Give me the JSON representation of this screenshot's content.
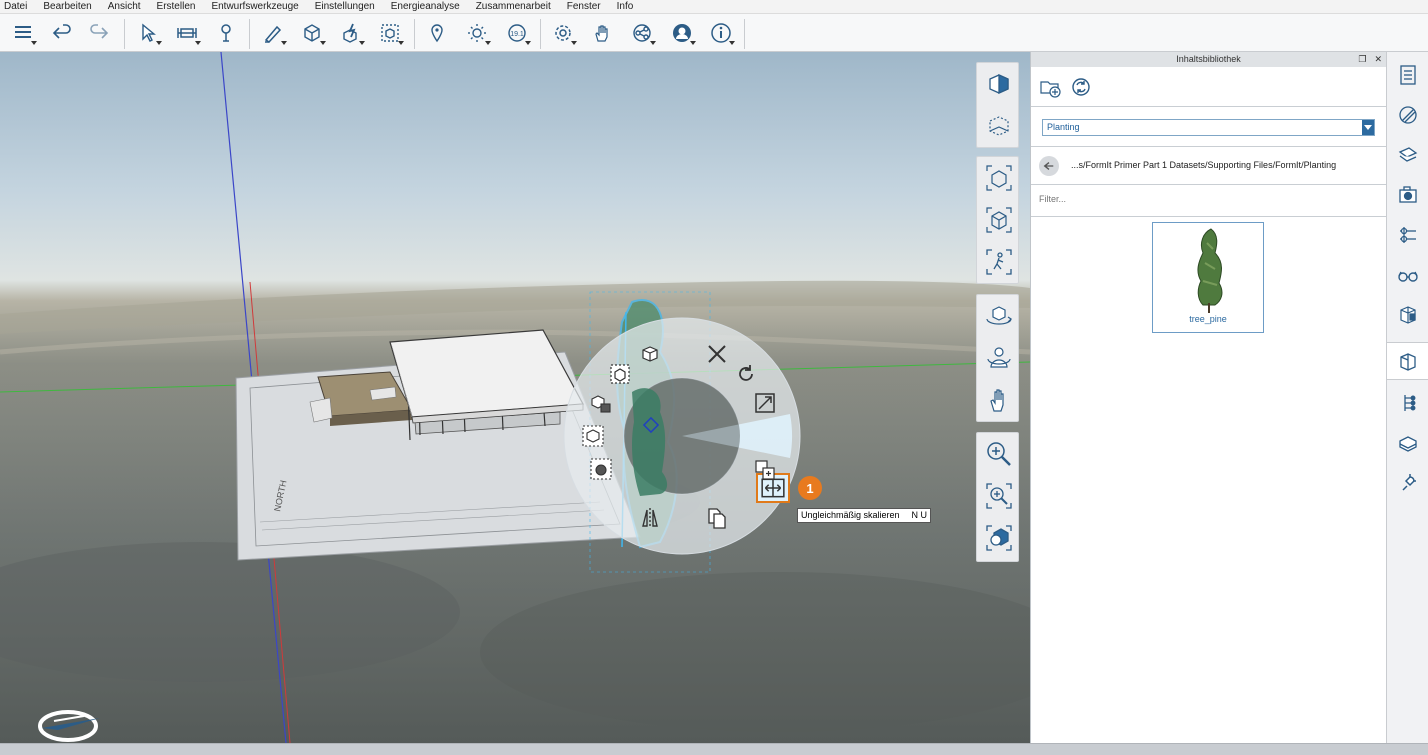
{
  "menu": [
    "Datei",
    "Bearbeiten",
    "Ansicht",
    "Erstellen",
    "Entwurfswerkzeuge",
    "Einstellungen",
    "Energieanalyse",
    "Zusammenarbeit",
    "Fenster",
    "Info"
  ],
  "toolbar": {
    "icons": [
      "layers-icon",
      "undo-icon",
      "redo-icon",
      "select-icon",
      "measure-icon",
      "paint-icon",
      "sketch-icon",
      "box-icon",
      "extrude-icon",
      "group-icon",
      "location-icon",
      "sun-icon",
      "date-icon",
      "settings-icon",
      "hand-icon",
      "share-icon",
      "user-icon",
      "info-icon"
    ]
  },
  "marking_menu": {
    "selected_tool": "nonuniform-scale",
    "callout_number": "1",
    "tooltip": {
      "label": "Ungleichmäßig skalieren",
      "shortcut": "N U"
    }
  },
  "panel": {
    "title": "Inhaltsbibliothek",
    "category": "Planting",
    "path": "...s/FormIt Primer Part 1 Datasets/Supporting Files/FormIt/Planting",
    "filter_placeholder": "Filter...",
    "items": [
      {
        "label": "tree_pine"
      }
    ]
  },
  "colors": {
    "accent": "#2c6aa0",
    "highlight": "#e87a1e",
    "selection": "#3fb8f0"
  }
}
